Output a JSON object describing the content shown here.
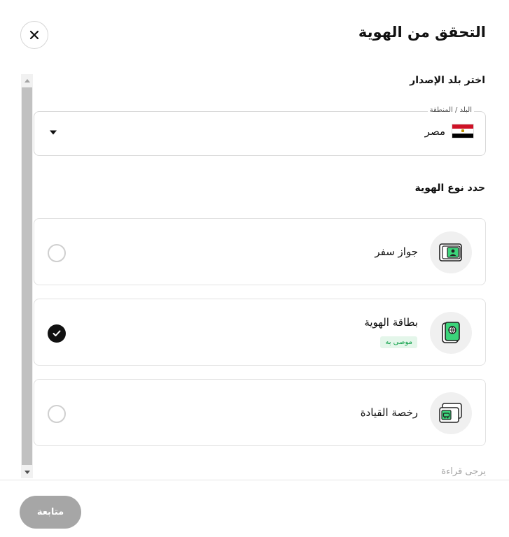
{
  "header": {
    "title": "التحقق من الهوية"
  },
  "country_section": {
    "label": "اختر بلد الإصدار",
    "field_label": "البلد / المنطقة",
    "selected_value": "مصر",
    "flag_icon": "egypt-flag-icon"
  },
  "id_type_section": {
    "label": "حدد نوع الهوية",
    "options": [
      {
        "label": "جواز سفر",
        "icon": "passport-icon",
        "selected": false
      },
      {
        "label": "بطاقة الهوية",
        "icon": "id-card-icon",
        "badge": "موصى به",
        "selected": true
      },
      {
        "label": "رخصة القيادة",
        "icon": "driving-license-icon",
        "selected": false
      }
    ]
  },
  "footer": {
    "note": "يرجى قراءة",
    "continue_label": "متابعة"
  },
  "colors": {
    "accent_green": "#11a14a",
    "badge_bg": "#e4f6ea",
    "button_disabled": "#a6a6a6"
  }
}
